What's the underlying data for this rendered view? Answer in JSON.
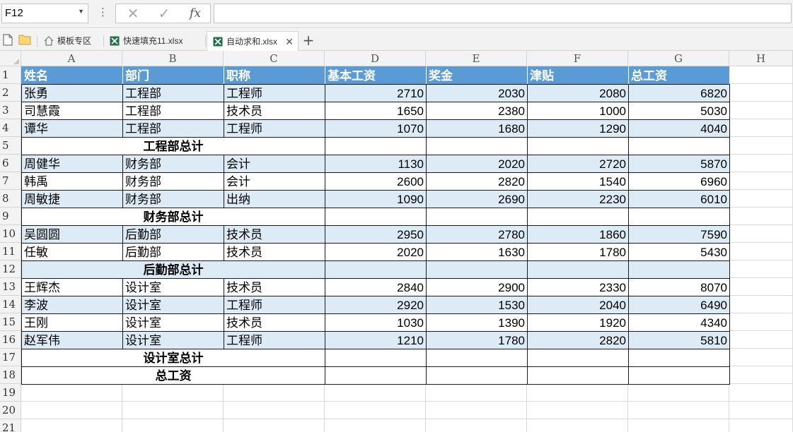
{
  "formula_bar": {
    "name_box": "F12",
    "cancel_icon": "✕",
    "enter_icon": "✓",
    "fx_label": "fx",
    "formula_value": ""
  },
  "tabs": [
    {
      "label": "模板专区",
      "icon": "home-icon",
      "active": false
    },
    {
      "label": "快速填充11.xlsx",
      "icon": "excel-file-icon",
      "active": false
    },
    {
      "label": "自动求和.xlsx",
      "icon": "excel-file-icon",
      "active": true
    }
  ],
  "add_tab_label": "+",
  "columns": [
    "A",
    "B",
    "C",
    "D",
    "E",
    "F",
    "G",
    "H"
  ],
  "rows": [
    "1",
    "2",
    "3",
    "4",
    "5",
    "6",
    "7",
    "8",
    "9",
    "10",
    "11",
    "12",
    "13",
    "14",
    "15",
    "16",
    "17",
    "18",
    "19",
    "20",
    "21"
  ],
  "colors": {
    "header_fill": "#5b9bd5",
    "band_fill": "#ddebf7",
    "excel_green": "#1e7145"
  },
  "sheet": {
    "header": [
      "姓名",
      "部门",
      "职称",
      "基本工资",
      "奖金",
      "津贴",
      "总工资"
    ],
    "body": [
      {
        "type": "data",
        "band": true,
        "cells": [
          "张勇",
          "工程部",
          "工程师",
          "2710",
          "2030",
          "2080",
          "6820"
        ]
      },
      {
        "type": "data",
        "band": false,
        "cells": [
          "司慧霞",
          "工程部",
          "技术员",
          "1650",
          "2380",
          "1000",
          "5030"
        ]
      },
      {
        "type": "data",
        "band": true,
        "cells": [
          "谭华",
          "工程部",
          "工程师",
          "1070",
          "1680",
          "1290",
          "4040"
        ]
      },
      {
        "type": "subtotal",
        "band": false,
        "label": "工程部总计"
      },
      {
        "type": "data",
        "band": true,
        "cells": [
          "周健华",
          "财务部",
          "会计",
          "1130",
          "2020",
          "2720",
          "5870"
        ]
      },
      {
        "type": "data",
        "band": false,
        "cells": [
          "韩禹",
          "财务部",
          "会计",
          "2600",
          "2820",
          "1540",
          "6960"
        ]
      },
      {
        "type": "data",
        "band": true,
        "cells": [
          "周敏捷",
          "财务部",
          "出纳",
          "1090",
          "2690",
          "2230",
          "6010"
        ]
      },
      {
        "type": "subtotal",
        "band": false,
        "label": "财务部总计"
      },
      {
        "type": "data",
        "band": true,
        "cells": [
          "吴圆圆",
          "后勤部",
          "技术员",
          "2950",
          "2780",
          "1860",
          "7590"
        ]
      },
      {
        "type": "data",
        "band": false,
        "cells": [
          "任敏",
          "后勤部",
          "技术员",
          "2020",
          "1630",
          "1780",
          "5430"
        ]
      },
      {
        "type": "subtotal",
        "band": true,
        "label": "后勤部总计"
      },
      {
        "type": "data",
        "band": false,
        "cells": [
          "王辉杰",
          "设计室",
          "技术员",
          "2840",
          "2900",
          "2330",
          "8070"
        ]
      },
      {
        "type": "data",
        "band": true,
        "cells": [
          "李波",
          "设计室",
          "工程师",
          "2920",
          "1530",
          "2040",
          "6490"
        ]
      },
      {
        "type": "data",
        "band": false,
        "cells": [
          "王刚",
          "设计室",
          "技术员",
          "1030",
          "1390",
          "1920",
          "4340"
        ]
      },
      {
        "type": "data",
        "band": true,
        "cells": [
          "赵军伟",
          "设计室",
          "工程师",
          "1210",
          "1780",
          "2820",
          "5810"
        ]
      },
      {
        "type": "subtotal",
        "band": false,
        "label": "设计室总计"
      },
      {
        "type": "subtotal",
        "band": false,
        "label": "总工资"
      }
    ]
  }
}
